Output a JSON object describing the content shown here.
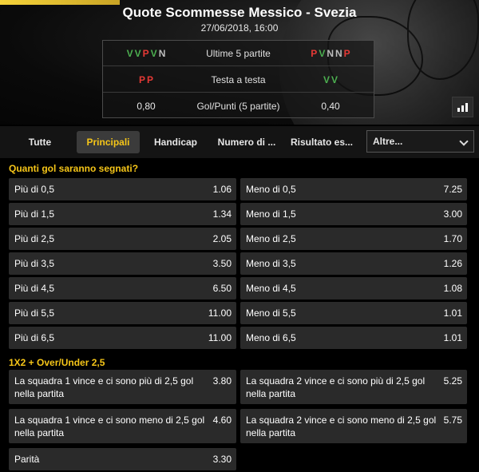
{
  "match": {
    "title": "Quote Scommesse Messico - Svezia",
    "date": "27/06/2018, 16:00"
  },
  "stats": {
    "rows": [
      {
        "left": [
          "V",
          "V",
          "P",
          "V",
          "N"
        ],
        "label": "Ultime 5 partite",
        "right": [
          "P",
          "V",
          "N",
          "N",
          "P"
        ]
      },
      {
        "left": [
          "P",
          "P"
        ],
        "label": "Testa a testa",
        "right": [
          "V",
          "V"
        ]
      },
      {
        "left_value": "0,80",
        "label": "Gol/Punti (5 partite)",
        "right_value": "0,40"
      }
    ]
  },
  "tabs": [
    {
      "label": "Tutte",
      "active": false
    },
    {
      "label": "Principali",
      "active": true
    },
    {
      "label": "Handicap",
      "active": false
    },
    {
      "label": "Numero di ...",
      "active": false
    },
    {
      "label": "Risultato es...",
      "active": false
    }
  ],
  "more_select": {
    "selected": "Altre..."
  },
  "sections": [
    {
      "title": "Quanti gol saranno segnati?",
      "rows": [
        [
          {
            "label": "Più di 0,5",
            "odds": "1.06"
          },
          {
            "label": "Meno di 0,5",
            "odds": "7.25"
          }
        ],
        [
          {
            "label": "Più di 1,5",
            "odds": "1.34"
          },
          {
            "label": "Meno di 1,5",
            "odds": "3.00"
          }
        ],
        [
          {
            "label": "Più di 2,5",
            "odds": "2.05"
          },
          {
            "label": "Meno di 2,5",
            "odds": "1.70"
          }
        ],
        [
          {
            "label": "Più di 3,5",
            "odds": "3.50"
          },
          {
            "label": "Meno di 3,5",
            "odds": "1.26"
          }
        ],
        [
          {
            "label": "Più di 4,5",
            "odds": "6.50"
          },
          {
            "label": "Meno di 4,5",
            "odds": "1.08"
          }
        ],
        [
          {
            "label": "Più di 5,5",
            "odds": "11.00"
          },
          {
            "label": "Meno di 5,5",
            "odds": "1.01"
          }
        ],
        [
          {
            "label": "Più di 6,5",
            "odds": "11.00"
          },
          {
            "label": "Meno di 6,5",
            "odds": "1.01"
          }
        ]
      ]
    },
    {
      "title": "1X2 + Over/Under 2,5",
      "rows": [
        [
          {
            "label": "La squadra 1 vince e ci sono più di 2,5 gol nella partita",
            "odds": "3.80"
          },
          {
            "label": "La squadra 2 vince e ci sono più di 2,5 gol nella partita",
            "odds": "5.25"
          }
        ],
        [
          {
            "label": "La squadra 1 vince e ci sono meno di 2,5 gol nella partita",
            "odds": "4.60"
          },
          {
            "label": "La squadra 2 vince e ci sono meno di 2,5 gol nella partita",
            "odds": "5.75"
          }
        ],
        [
          {
            "label": "Parità",
            "odds": "3.30"
          }
        ]
      ]
    }
  ],
  "colors": {
    "accent": "#f5c518",
    "win": "#4caf50",
    "loss": "#e53935",
    "draw": "#bdbdbd",
    "cell_bg": "#2a2a2a"
  },
  "icons": {
    "stats": "bar-chart-icon",
    "dropdown": "chevron-down-icon"
  }
}
